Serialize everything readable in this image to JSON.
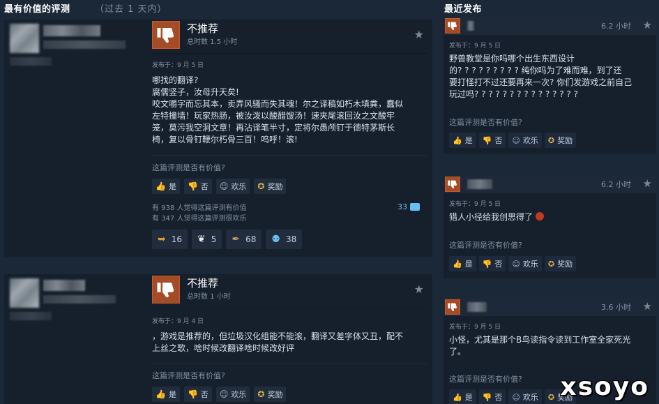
{
  "left_header": {
    "title": "最有价值的评测",
    "sub": "（过去 1 天内）"
  },
  "right_header": {
    "title": "最近发布"
  },
  "labels": {
    "helpful_q": "这篇评测是否有价值?",
    "yes": "是",
    "no": "否",
    "funny": "欢乐",
    "award": "奖励"
  },
  "reviews": [
    {
      "recommendation": "不推荐",
      "hours": "总时数 1.5 小时",
      "posted": "发布于：9 月 5 日",
      "body_lines": [
        "哪找的翻译?",
        "腐儒竖子，汝母升天矣!",
        "咬文嚼字而忘其本，卖弄风骚而失其魂！尔之译稿如朽木填粪，蠢似",
        "左特撞墙！玩家热肠，被汝泼以酸醋馊汤！速夹尾滚回汝之文酸牢",
        "笼，莫污我空洞文章！再沾译笔半寸，定将尔愚颅钉于德特茅斯长",
        "椅，复以骨钉鞭尔朽骨三百！呜呼！滚!"
      ],
      "stat_helpful": "有 938 人觉得这篇评测有价值",
      "stat_funny": "有 347 人觉得这篇评测很欢乐",
      "comments": "33",
      "awards": [
        {
          "icon": "boot-icon",
          "count": "16",
          "glyph": "⮕",
          "color": "#e39b2b"
        },
        {
          "icon": "wings-icon",
          "count": "5",
          "glyph": "❧",
          "color": "#f0f0f0"
        },
        {
          "icon": "scroll-icon",
          "count": "68",
          "glyph": "✒",
          "color": "#c9a36a"
        },
        {
          "icon": "medal-icon",
          "count": "38",
          "glyph": "⚉",
          "color": "#66c0f4"
        }
      ]
    },
    {
      "recommendation": "不推荐",
      "hours": "总时数 1 小时",
      "posted": "发布于：9 月 4 日",
      "body_lines": [
        "，游戏是推荐的，但垃圾汉化组能不能滚，翻译又差字体又丑，配不",
        "上丝之歌，啥时候改翻译啥时候改好评"
      ]
    }
  ],
  "recent": [
    {
      "time": "6.2 小时",
      "posted": "发布于：9 月 5 日",
      "body_lines": [
        "野兽教堂是你吗哪个出生东西设计",
        "的? ? ? ? ? ? ? ? ? 纯你吗为了难而难，到了还",
        "要打怪打不过还要再来一次? 你们发游戏之前自己",
        "玩过吗? ? ? ? ? ? ? ? ? ? ? ? ? ? ?"
      ]
    },
    {
      "time": "6.2 小时",
      "posted": "发布于：9 月 5 日",
      "body_lines": [
        "猎人小径给我创思得了"
      ]
    },
    {
      "time": "3.6 小时",
      "posted": "发布于：9 月 5 日",
      "body_lines": [
        "小怪，尤其是那个B鸟读指令读到工作室全家死光",
        "了。"
      ]
    }
  ],
  "watermark": "xsoyo"
}
